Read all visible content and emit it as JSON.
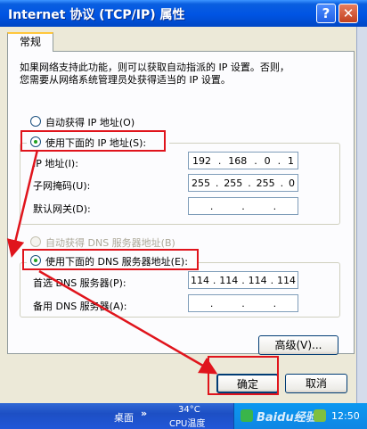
{
  "window": {
    "title": "Internet 协议 (TCP/IP) 属性",
    "help_glyph": "?",
    "close_glyph": "✕"
  },
  "tab": {
    "label": "常规"
  },
  "description": {
    "line1": "如果网络支持此功能，则可以获取自动指派的 IP 设置。否则，",
    "line2": "您需要从网络系统管理员处获得适当的 IP 设置。"
  },
  "ip": {
    "auto_option": "自动获得 IP 地址(O)",
    "manual_option": "使用下面的 IP 地址(S):",
    "selected": "manual",
    "fields": [
      {
        "label": "IP 地址(I):",
        "octets": [
          "192",
          "168",
          "0",
          "1"
        ]
      },
      {
        "label": "子网掩码(U):",
        "octets": [
          "255",
          "255",
          "255",
          "0"
        ]
      },
      {
        "label": "默认网关(D):",
        "octets": [
          "",
          "",
          "",
          ""
        ]
      }
    ]
  },
  "dns": {
    "auto_option": "自动获得 DNS 服务器地址(B)",
    "manual_option": "使用下面的 DNS 服务器地址(E):",
    "selected": "manual",
    "fields": [
      {
        "label": "首选 DNS 服务器(P):",
        "octets": [
          "114",
          "114",
          "114",
          "114"
        ]
      },
      {
        "label": "备用 DNS 服务器(A):",
        "octets": [
          "",
          "",
          "",
          ""
        ]
      }
    ]
  },
  "buttons": {
    "advanced": "高级(V)...",
    "ok": "确定",
    "cancel": "取消"
  },
  "taskbar": {
    "desktop_label": "桌面",
    "chevron": "»",
    "temperature": "34°C",
    "cpu_label": "CPU温度",
    "time": "12:50",
    "watermark": "Baidu经验"
  },
  "colors": {
    "annotation_red": "#e0141c",
    "title_blue": "#0054e3",
    "taskbar_blue": "#2157d8",
    "radio_dot_green": "#21a121"
  }
}
